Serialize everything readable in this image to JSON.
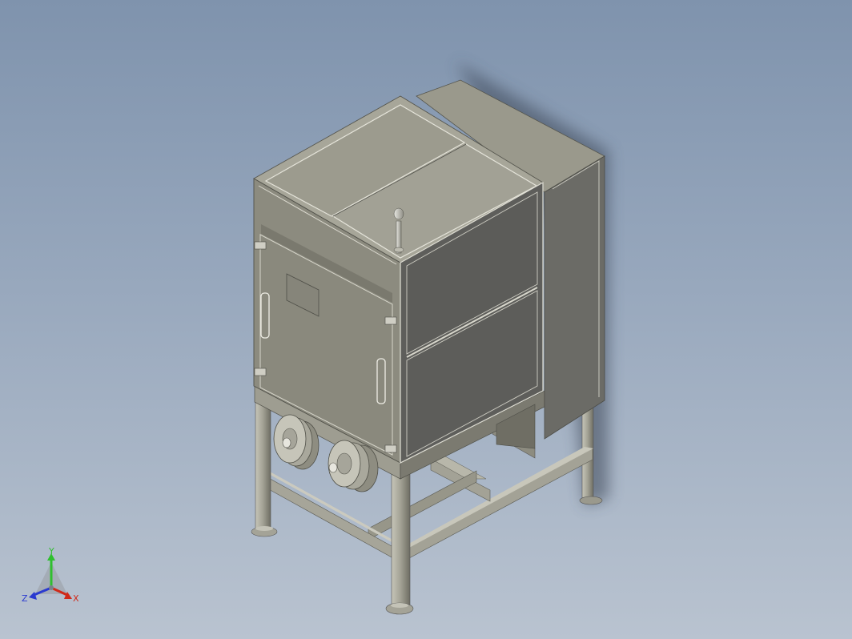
{
  "viewport": {
    "background_top": "#7f93ad",
    "background_bottom": "#b9c3d0"
  },
  "model": {
    "colors": {
      "steel_light": "#a9a899",
      "steel_mid": "#8e8d80",
      "steel_dark": "#6f6e64",
      "panel_dark": "#5f5f5c",
      "edge": "#e4e3da",
      "shadow": "#4d5766"
    }
  },
  "triad": {
    "y_label": "Y",
    "x_label": "X",
    "z_label": "Z",
    "y_color": "#2fbf2f",
    "x_color": "#d02a1a",
    "z_color": "#2a3ad0"
  }
}
